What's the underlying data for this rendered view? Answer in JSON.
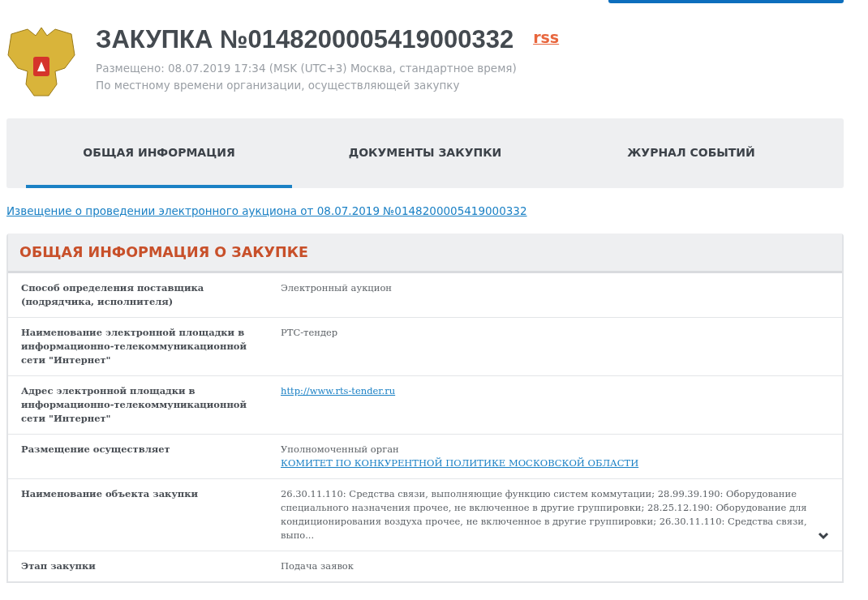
{
  "header": {
    "title": "ЗАКУПКА №0148200005419000332",
    "rss": "rss",
    "posted": "Размещено: 08.07.2019 17:34 (MSK (UTC+3) Москва, стандартное время)",
    "note": "По местному времени организации, осуществляющей закупку"
  },
  "tabs": [
    {
      "label": "ОБЩАЯ ИНФОРМАЦИЯ",
      "selected": true
    },
    {
      "label": "ДОКУМЕНТЫ ЗАКУПКИ",
      "selected": false
    },
    {
      "label": "ЖУРНАЛ СОБЫТИЙ",
      "selected": false
    }
  ],
  "notice_link": "Извещение о проведении электронного аукциона от 08.07.2019 №0148200005419000332",
  "section": {
    "title": "ОБЩАЯ ИНФОРМАЦИЯ О ЗАКУПКЕ",
    "rows": [
      {
        "kind": "text",
        "label": "Способ определения поставщика (подрядчика, исполнителя)",
        "value": "Электронный аукцион"
      },
      {
        "kind": "text",
        "label": "Наименование электронной площадки в информационно-телекоммуникационной сети \"Интернет\"",
        "value": "РТС-тендер"
      },
      {
        "kind": "link",
        "label": "Адрес электронной площадки в информационно-телекоммуникационной сети \"Интернет\"",
        "value": "http://www.rts-tender.ru"
      },
      {
        "kind": "text-link",
        "label": "Размещение осуществляет",
        "value": "Уполномоченный орган",
        "link": "КОМИТЕТ ПО КОНКУРЕНТНОЙ ПОЛИТИКЕ МОСКОВСКОЙ ОБЛАСТИ"
      },
      {
        "kind": "expandable",
        "label": "Наименование объекта закупки",
        "value": "26.30.11.110: Средства связи, выполняющие функцию систем коммутации; 28.99.39.190: Оборудование специального назначения прочее, не включенное в другие группировки; 28.25.12.190: Оборудование для кондиционирования воздуха прочее, не включенное в другие группировки; 26.30.11.110: Средства связи, выпо..."
      },
      {
        "kind": "text",
        "label": "Этап закупки",
        "value": "Подача заявок"
      }
    ]
  }
}
